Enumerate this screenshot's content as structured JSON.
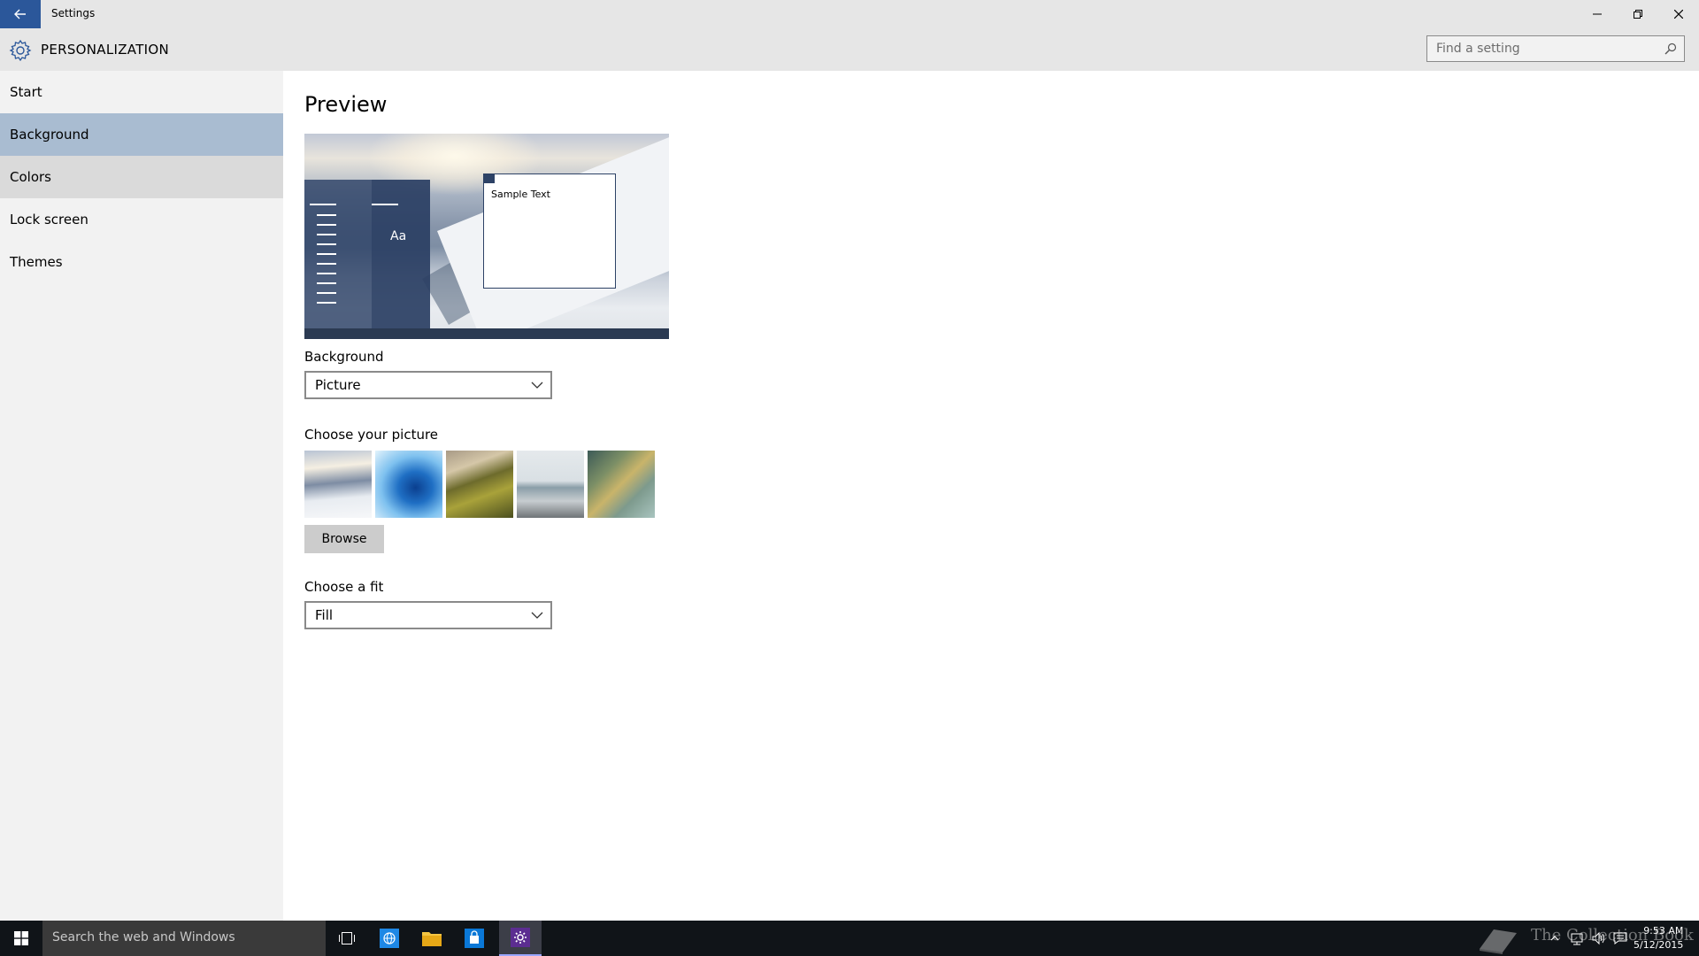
{
  "window": {
    "title": "Settings",
    "controls": [
      "minimize",
      "restore",
      "close"
    ]
  },
  "header": {
    "title": "PERSONALIZATION",
    "icon": "gear-icon",
    "search_placeholder": "Find a setting"
  },
  "sidebar": {
    "items": [
      {
        "label": "Start",
        "state": "normal"
      },
      {
        "label": "Background",
        "state": "selected"
      },
      {
        "label": "Colors",
        "state": "hover"
      },
      {
        "label": "Lock screen",
        "state": "normal"
      },
      {
        "label": "Themes",
        "state": "normal"
      }
    ]
  },
  "main": {
    "preview_title": "Preview",
    "preview_tile_text": "Aa",
    "preview_sample_text": "Sample Text",
    "background_label": "Background",
    "background_value": "Picture",
    "choose_picture_label": "Choose your picture",
    "browse_label": "Browse",
    "fit_label": "Choose a fit",
    "fit_value": "Fill"
  },
  "taskbar": {
    "search_text": "Search the web and Windows",
    "time": "9:53 AM",
    "date": "5/12/2015",
    "watermark": "The Collection Book"
  },
  "colors": {
    "accent": "#2b579a",
    "selected_nav": "#a9bcd1",
    "taskbar": "#101418"
  }
}
